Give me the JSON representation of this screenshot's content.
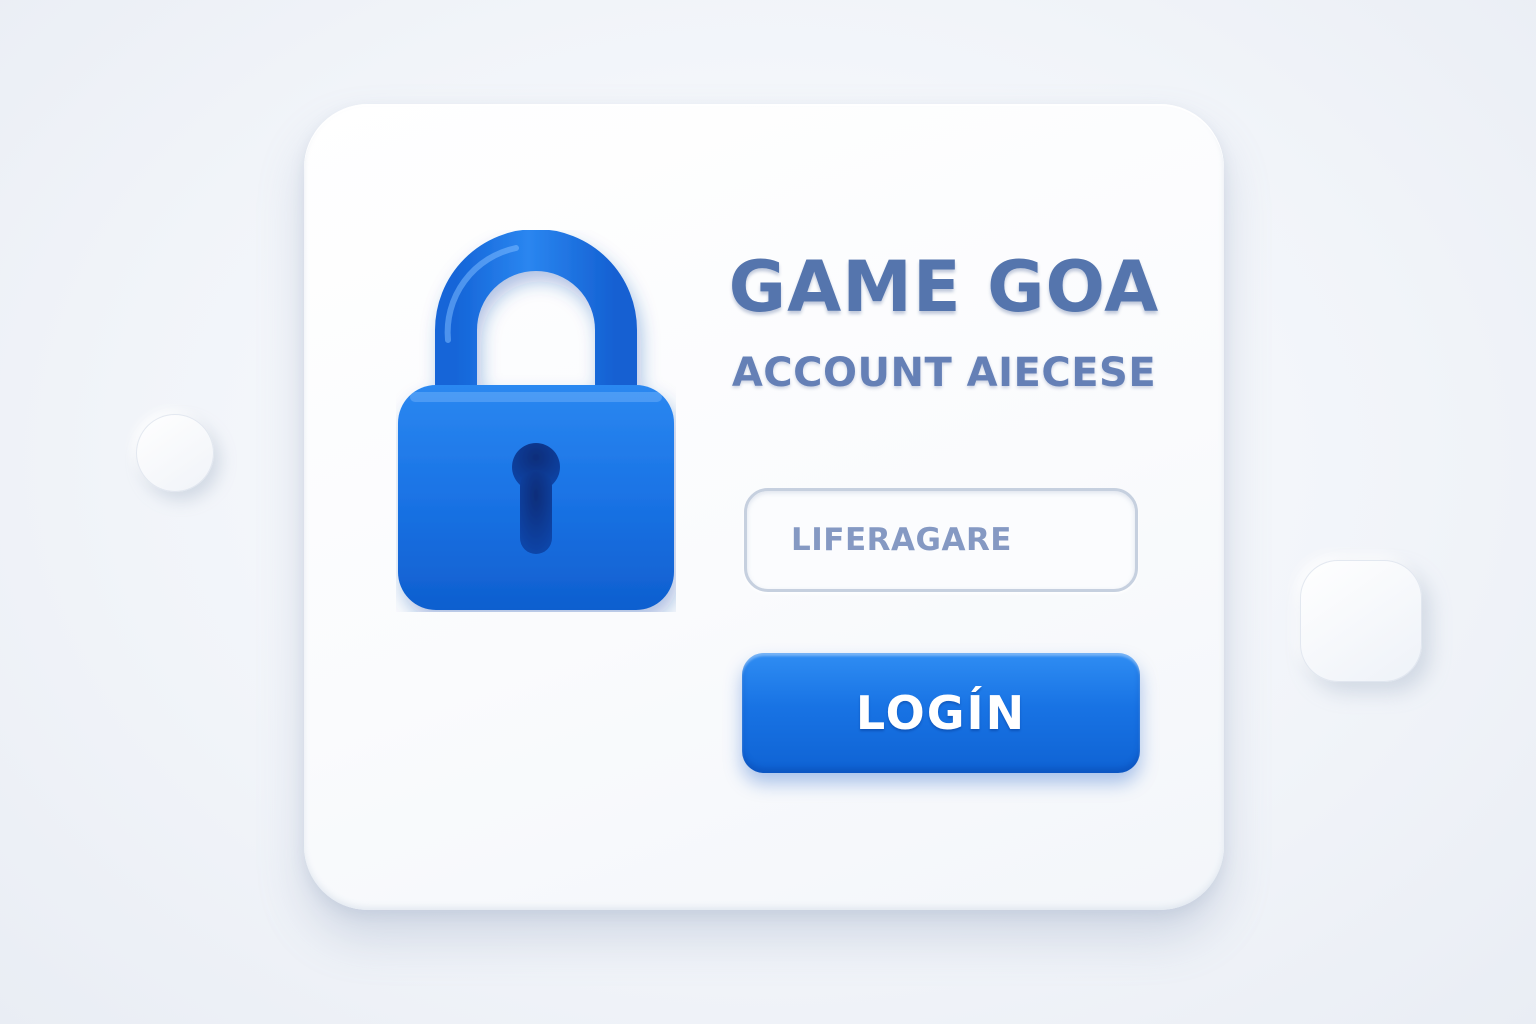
{
  "header": {
    "title": "GAME GOA",
    "subtitle": "ACCOUNT AIECESE"
  },
  "form": {
    "field_value": "LIFERAGARE",
    "login_label": "LOGÍN"
  },
  "icons": {
    "lock": "padlock-icon"
  },
  "colors": {
    "accent": "#1873e4",
    "title": "#5575ad",
    "field_text": "#8599c3",
    "field_border": "#c6d0df",
    "background": "#f1f4f9"
  }
}
